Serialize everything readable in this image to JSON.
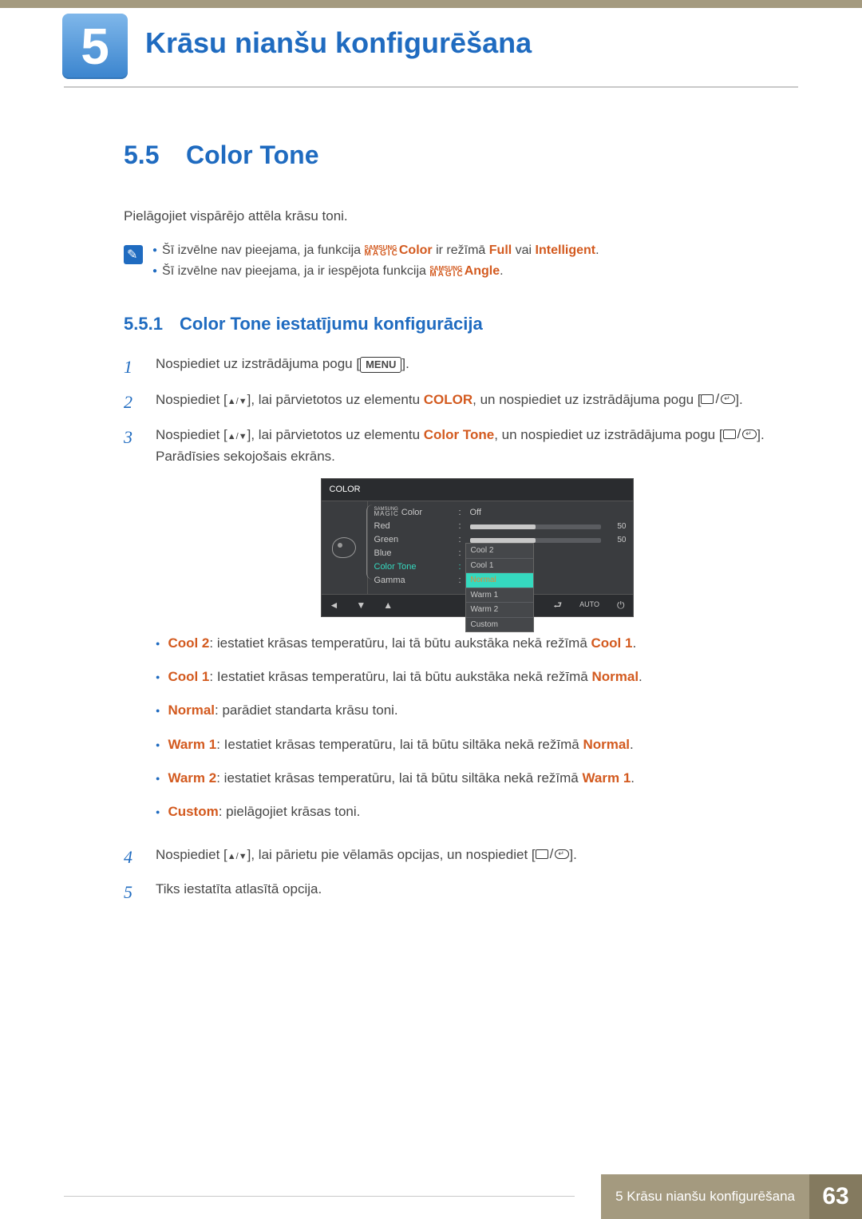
{
  "chapter": {
    "number": "5",
    "title": "Krāsu nianšu konfigurēšana"
  },
  "section": {
    "number": "5.5",
    "title": "Color Tone"
  },
  "intro": "Pielāgojiet vispārējo attēla krāsu toni.",
  "notes": {
    "n1_a": "Šī izvēlne nav pieejama, ja funkcija ",
    "n1_b": "Color",
    "n1_c": " ir režīmā ",
    "n1_d": "Full",
    "n1_e": " vai ",
    "n1_f": "Intelligent",
    "n1_g": ".",
    "n2_a": "Šī izvēlne nav pieejama, ja ir iespējota funkcija ",
    "n2_b": "Angle",
    "n2_c": "."
  },
  "sm": {
    "top": "SAMSUNG",
    "bot": "MAGIC"
  },
  "subsection": {
    "number": "5.5.1",
    "title": "Color Tone iestatījumu konfigurācija"
  },
  "steps": {
    "s1": {
      "num": "1",
      "a": "Nospiediet uz izstrādājuma pogu [",
      "b": "MENU",
      "c": "]."
    },
    "s2": {
      "num": "2",
      "a": "Nospiediet [",
      "b": "], lai pārvietotos uz elementu ",
      "c": "COLOR",
      "d": ", un nospiediet uz izstrādājuma pogu [",
      "e": "]."
    },
    "s3": {
      "num": "3",
      "a": "Nospiediet [",
      "b": "], lai pārvietotos uz elementu ",
      "c": "Color Tone",
      "d": ", un nospiediet uz izstrādājuma pogu [",
      "e": "]. Parādīsies sekojošais ekrāns."
    },
    "s4": {
      "num": "4",
      "a": "Nospiediet [",
      "b": "], lai pārietu pie vēlamās opcijas, un nospiediet [",
      "c": "]."
    },
    "s5": {
      "num": "5",
      "a": "Tiks iestatīta atlasītā opcija."
    }
  },
  "options": {
    "o1": {
      "k": "Cool 2",
      "v": ": iestatiet krāsas temperatūru, lai tā būtu aukstāka nekā režīmā ",
      "r": "Cool 1",
      "end": "."
    },
    "o2": {
      "k": "Cool 1",
      "v": ": Iestatiet krāsas temperatūru, lai tā būtu aukstāka nekā režīmā ",
      "r": "Normal",
      "end": "."
    },
    "o3": {
      "k": "Normal",
      "v": ": parādiet standarta krāsu toni.",
      "r": "",
      "end": ""
    },
    "o4": {
      "k": "Warm 1",
      "v": ": Iestatiet krāsas temperatūru, lai tā būtu siltāka nekā režīmā ",
      "r": "Normal",
      "end": "."
    },
    "o5": {
      "k": "Warm 2",
      "v": ": iestatiet krāsas temperatūru, lai tā būtu siltāka nekā režīmā ",
      "r": "Warm 1",
      "end": "."
    },
    "o6": {
      "k": "Custom",
      "v": ": pielāgojiet krāsas toni.",
      "r": "",
      "end": ""
    }
  },
  "osd": {
    "title": "COLOR",
    "rows": {
      "magic": {
        "label": " Color",
        "val": "Off"
      },
      "red": {
        "label": "Red",
        "num": "50",
        "fill": 50
      },
      "green": {
        "label": "Green",
        "num": "50",
        "fill": 50
      },
      "blue": {
        "label": "Blue"
      },
      "ct": {
        "label": "Color Tone"
      },
      "gamma": {
        "label": "Gamma"
      }
    },
    "dropdown": [
      "Cool 2",
      "Cool 1",
      "Normal",
      "Warm 1",
      "Warm 2",
      "Custom"
    ],
    "selected": "Normal",
    "foot_auto": "AUTO"
  },
  "footer": {
    "text": "5 Krāsu nianšu konfigurēšana",
    "page": "63"
  }
}
